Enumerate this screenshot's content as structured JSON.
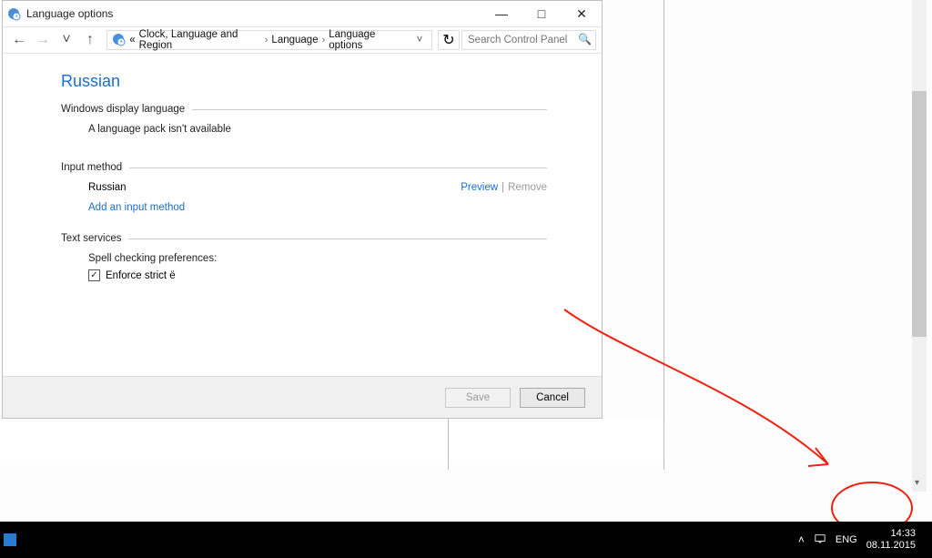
{
  "window": {
    "title": "Language options",
    "control_buttons": {
      "min": "—",
      "max": "□",
      "close": "✕"
    }
  },
  "toolbar": {
    "back": "←",
    "forward": "→",
    "recent": "˅",
    "up": "↑",
    "breadcrumb_arrow": "«",
    "breadcrumb": [
      "Clock, Language and Region",
      "Language",
      "Language options"
    ],
    "sep": "›",
    "dropdown": "˅",
    "refresh": "↻",
    "search_placeholder": "Search Control Panel"
  },
  "main": {
    "language_title": "Russian",
    "sections": {
      "display": {
        "header": "Windows display language",
        "msg": "A language pack isn't available"
      },
      "input": {
        "header": "Input method",
        "item": "Russian",
        "preview": "Preview",
        "remove": "Remove",
        "add": "Add an input method"
      },
      "text": {
        "header": "Text services",
        "spell_label": "Spell checking preferences:",
        "check_label": "Enforce strict ё",
        "checked": "✓"
      }
    }
  },
  "footer": {
    "save": "Save",
    "cancel": "Cancel"
  },
  "taskbar": {
    "lang": "ENG",
    "time": "14:33",
    "date": "08.11.2015"
  }
}
